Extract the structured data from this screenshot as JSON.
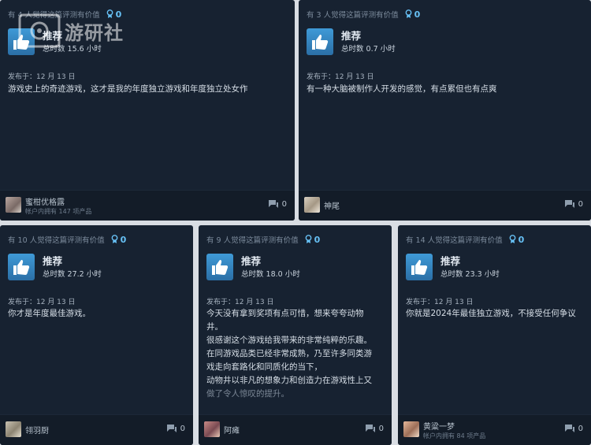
{
  "reviews": [
    {
      "helpful_text": "有 4 人觉得这篇评测有价值",
      "awards": "0",
      "recommendation": "推荐",
      "hours": "总时数 15.6 小时",
      "posted": "发布于：12 月 13 日",
      "paragraphs": [
        "游戏史上的奇迹游戏，这才是我的年度独立游戏和年度独立处女作"
      ],
      "fade_paragraph": "",
      "username": "蜜柑优格露",
      "owned": "帐户内拥有 147 项产品",
      "comments": "0"
    },
    {
      "helpful_text": "有 3 人觉得这篇评测有价值",
      "awards": "0",
      "recommendation": "推荐",
      "hours": "总时数 0.7 小时",
      "posted": "发布于：12 月 13 日",
      "paragraphs": [
        "有一种大脑被制作人开发的感觉，有点累但也有点爽"
      ],
      "fade_paragraph": "",
      "username": "神尾",
      "owned": "",
      "comments": "0"
    },
    {
      "helpful_text": "有 10 人觉得这篇评测有价值",
      "awards": "0",
      "recommendation": "推荐",
      "hours": "总时数 27.2 小时",
      "posted": "发布于：12 月 13 日",
      "paragraphs": [
        "你才是年度最佳游戏。"
      ],
      "fade_paragraph": "",
      "username": "翎羽厨",
      "owned": "",
      "comments": "0"
    },
    {
      "helpful_text": "有 9 人觉得这篇评测有价值",
      "awards": "0",
      "recommendation": "推荐",
      "hours": "总时数 18.0 小时",
      "posted": "发布于：12 月 13 日",
      "paragraphs": [
        "今天没有拿到奖项有点可惜，想来夸夸动物井。",
        "很感谢这个游戏给我带来的非常纯粹的乐趣。",
        "在同游戏品类已经非常成熟，乃至许多同类游戏走向套路化和同质化的当下，",
        "动物井以非凡的想象力和创造力在游戏性上又"
      ],
      "fade_paragraph": "做了令人惊叹的提升。",
      "username": "阿瘫",
      "owned": "",
      "comments": "0"
    },
    {
      "helpful_text": "有 14 人觉得这篇评测有价值",
      "awards": "0",
      "recommendation": "推荐",
      "hours": "总时数 23.3 小时",
      "posted": "发布于：12 月 13 日",
      "paragraphs": [
        "你就是2024年最佳独立游戏，不接受任何争议"
      ],
      "fade_paragraph": "",
      "username": "黄粱一梦",
      "owned": "帐户内拥有 84 项产品",
      "comments": "0"
    }
  ],
  "watermark": "游研社"
}
